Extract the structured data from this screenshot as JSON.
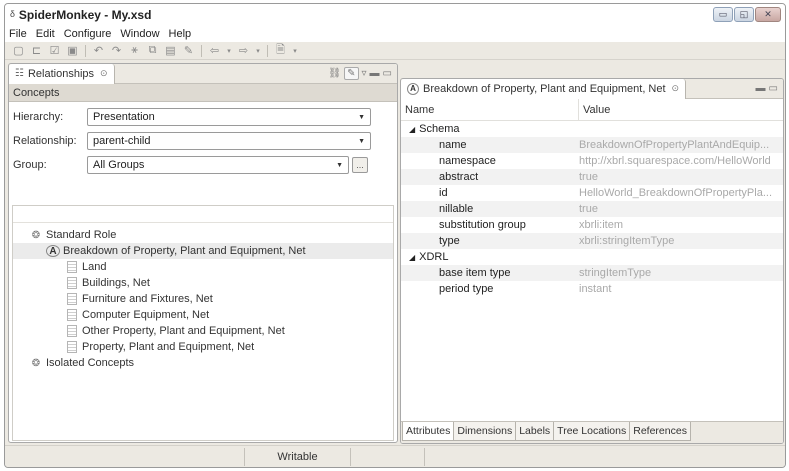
{
  "window": {
    "app_icon": "app-icon",
    "title": "SpiderMonkey - My.xsd",
    "controls": {
      "minimize": "minimize-icon",
      "maximize": "maximize-icon",
      "close": "close-icon"
    }
  },
  "menubar": {
    "items": [
      "File",
      "Edit",
      "Configure",
      "Window",
      "Help"
    ]
  },
  "toolbar": {
    "icons": [
      "new-icon",
      "open-icon",
      "checkbox-icon",
      "save-icon",
      "undo-icon",
      "redo-icon",
      "wand-icon",
      "copy-icon",
      "paste-icon",
      "pencil-icon",
      "back-icon",
      "dropdown-icon",
      "forward-icon",
      "dropdown-icon",
      "document-icon",
      "dropdown-icon"
    ]
  },
  "relationships_panel": {
    "tab_label": "Relationships",
    "tab_close": "⊙",
    "concepts_title": "Concepts",
    "hierarchy_label": "Hierarchy:",
    "hierarchy_value": "Presentation",
    "relationship_label": "Relationship:",
    "relationship_value": "parent-child",
    "group_label": "Group:",
    "group_value": "All Groups",
    "group_button": "...",
    "tree": [
      {
        "label": "Standard Role",
        "icon": "role-icon",
        "level": 0
      },
      {
        "label": "Breakdown of Property, Plant and Equipment, Net",
        "icon": "abstract-concept-icon",
        "level": 1,
        "selected": true
      },
      {
        "label": "Land",
        "icon": "document-icon",
        "level": 2
      },
      {
        "label": "Buildings, Net",
        "icon": "document-icon",
        "level": 2
      },
      {
        "label": "Furniture and Fixtures, Net",
        "icon": "document-icon",
        "level": 2
      },
      {
        "label": "Computer Equipment, Net",
        "icon": "document-icon",
        "level": 2
      },
      {
        "label": "Other Property, Plant and Equipment, Net",
        "icon": "document-icon",
        "level": 2
      },
      {
        "label": "Property, Plant and Equipment, Net",
        "icon": "document-icon",
        "level": 2
      },
      {
        "label": "Isolated Concepts",
        "icon": "role-icon",
        "level": 0
      }
    ]
  },
  "properties_panel": {
    "tab_label": "Breakdown of Property, Plant and Equipment, Net",
    "tab_close": "⊙",
    "col_name": "Name",
    "col_value": "Value",
    "rows": [
      {
        "name": "Schema",
        "value": "",
        "level": 0,
        "expander": true
      },
      {
        "name": "name",
        "value": "BreakdownOfPropertyPlantAndEquip...",
        "level": 1
      },
      {
        "name": "namespace",
        "value": "http://xbrl.squarespace.com/HelloWorld",
        "level": 1
      },
      {
        "name": "abstract",
        "value": "true",
        "level": 1
      },
      {
        "name": "id",
        "value": "HelloWorld_BreakdownOfPropertyPla...",
        "level": 1
      },
      {
        "name": "nillable",
        "value": "true",
        "level": 1
      },
      {
        "name": "substitution group",
        "value": "xbrli:item",
        "level": 1
      },
      {
        "name": "type",
        "value": "xbrli:stringItemType",
        "level": 1
      },
      {
        "name": "XDRL",
        "value": "",
        "level": 0,
        "expander": true
      },
      {
        "name": "base item type",
        "value": "stringItemType",
        "level": 1
      },
      {
        "name": "period type",
        "value": "instant",
        "level": 1
      }
    ],
    "bottom_tabs": [
      "Attributes",
      "Dimensions",
      "Labels",
      "Tree Locations",
      "References"
    ]
  },
  "statusbar": {
    "mode": "Writable"
  }
}
